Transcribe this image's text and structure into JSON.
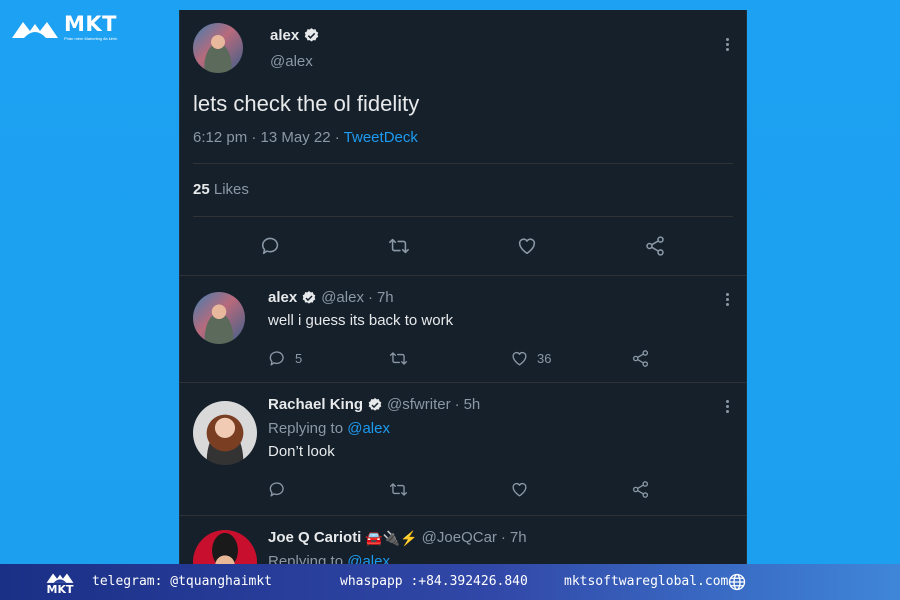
{
  "brand": {
    "name": "MKT",
    "tagline": "Phần mềm Marketing đa kênh"
  },
  "main_tweet": {
    "author_name": "alex",
    "author_handle": "@alex",
    "text": "lets check the ol fidelity",
    "time": "6:12 pm",
    "date": "13 May 22",
    "source": "TweetDeck",
    "likes_count": "25",
    "likes_label": "Likes"
  },
  "replies": [
    {
      "name": "alex",
      "handle": "@alex",
      "age": "7h",
      "text": "well i guess its back to work",
      "reply_count": "5",
      "retweet_count": "",
      "like_count": "36"
    },
    {
      "name": "Rachael King",
      "handle": "@sfwriter",
      "age": "5h",
      "replying_label": "Replying to",
      "replying_to": "@alex",
      "text": "Don’t look"
    },
    {
      "name": "Joe Q Carioti",
      "emoji": "🚘🔌⚡",
      "handle": "@JoeQCar",
      "age": "7h",
      "replying_label": "Replying to",
      "replying_to": "@alex"
    }
  ],
  "separator": "·",
  "footer": {
    "logo": "MKT",
    "telegram": "telegram: @tquanghaimkt",
    "whatsapp": "whaspapp :+84.392426.840",
    "website": "mktsoftwareglobal.com"
  },
  "colors": {
    "background": "#1da1f2",
    "panel": "#15202b",
    "link": "#1d9bf0",
    "muted": "#8b98a5"
  }
}
